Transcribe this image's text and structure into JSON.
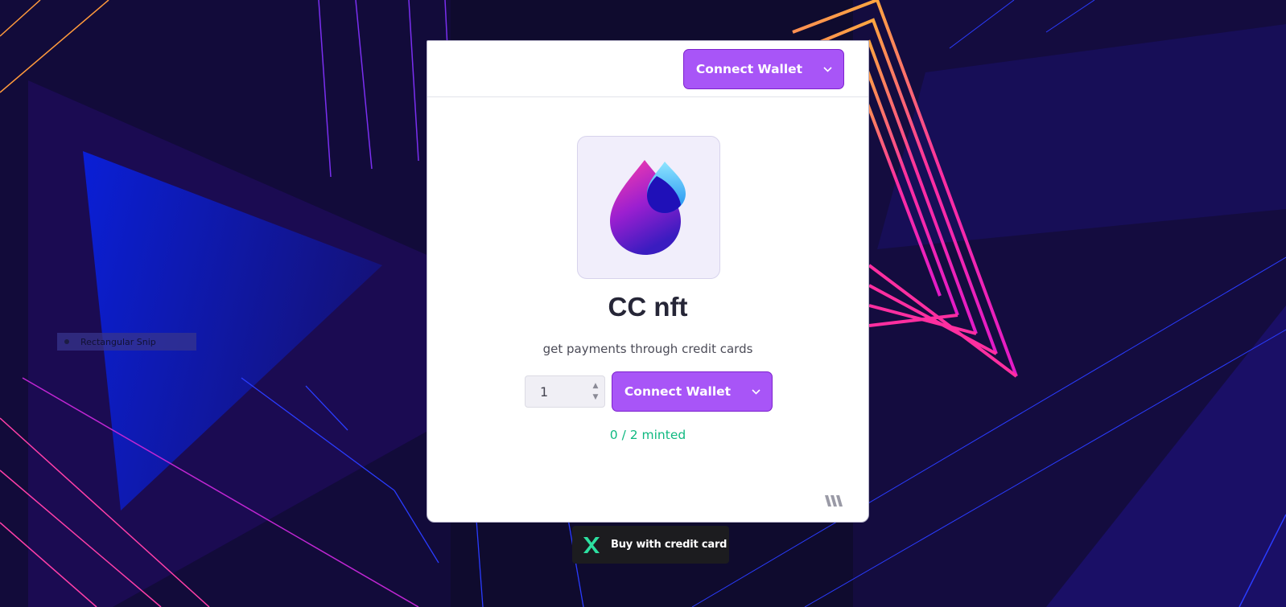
{
  "colors": {
    "accent": "#a855f7",
    "accent_border": "#7e22ce",
    "minted": "#10b981",
    "background": "#0f0b2e"
  },
  "screen_hint": {
    "label": "Rectangular Snip"
  },
  "header": {
    "connect_wallet_label": "Connect Wallet",
    "chevron_icon": "chevron-down-icon"
  },
  "collection": {
    "logo_icon": "droplet-logo-icon",
    "title": "CC nft",
    "description": "get payments through credit cards"
  },
  "mint": {
    "quantity": "1",
    "connect_wallet_label": "Connect Wallet",
    "minted_status": "0 / 2 minted"
  },
  "footer": {
    "brand_icon": "thirdweb-logo-icon"
  },
  "credit_card": {
    "label": "Buy with credit card",
    "icon": "crossmint-logo-icon"
  }
}
